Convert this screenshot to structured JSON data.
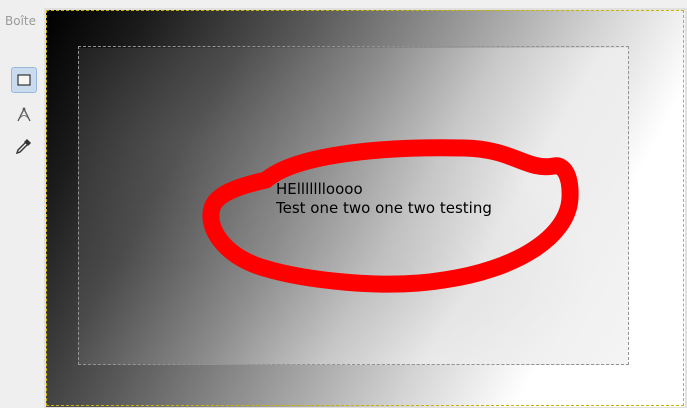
{
  "toolbox": {
    "title": "Boîte",
    "tools": [
      {
        "name": "rect-select-icon",
        "active": true
      },
      {
        "name": "paths-icon",
        "active": false
      },
      {
        "name": "color-picker-icon",
        "active": false
      }
    ]
  },
  "canvas": {
    "text_line1": "HEllllllloooo",
    "text_line2": "Test one two one two testing",
    "annotation_color": "#ff0000",
    "selection_color": "#000000",
    "layer_border_color": "#c8b400"
  }
}
